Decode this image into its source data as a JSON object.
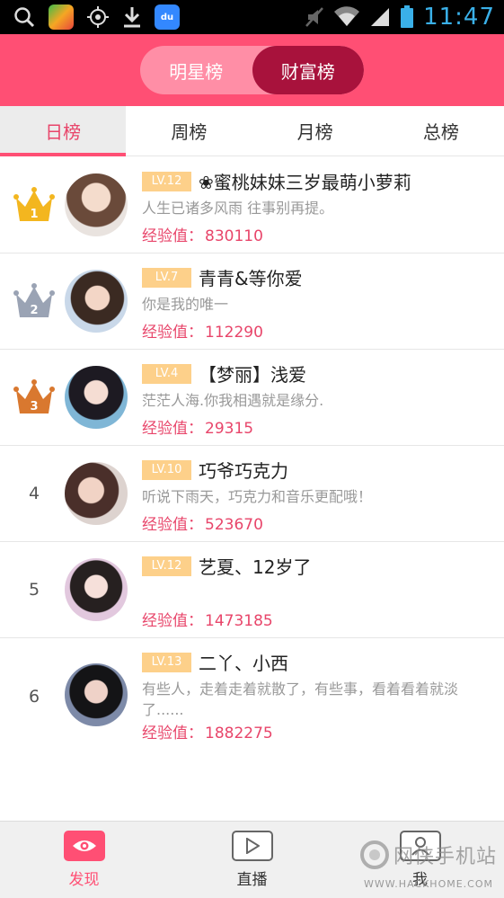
{
  "status_bar": {
    "time": "11:47",
    "icons": [
      "search-icon",
      "game-app-icon",
      "gps-icon",
      "download-icon",
      "baidu-app-icon",
      "mute-icon",
      "wifi-icon",
      "signal-icon",
      "battery-icon"
    ],
    "baidu_label": "du"
  },
  "header": {
    "segments": [
      {
        "label": "明星榜",
        "active": false
      },
      {
        "label": "财富榜",
        "active": true
      }
    ]
  },
  "tabs": [
    {
      "label": "日榜",
      "active": true
    },
    {
      "label": "周榜",
      "active": false
    },
    {
      "label": "月榜",
      "active": false
    },
    {
      "label": "总榜",
      "active": false
    }
  ],
  "list": [
    {
      "rank": "1",
      "crown": "gold",
      "level": "LV.12",
      "name": "❀蜜桃妹妹三岁最萌小萝莉",
      "signature": "人生已诸多风雨 往事别再提。",
      "exp_label": "经验值：",
      "exp_value": "830110"
    },
    {
      "rank": "2",
      "crown": "silver",
      "level": "LV.7",
      "name": "青青&等你爱",
      "signature": "你是我的唯一",
      "exp_label": "经验值：",
      "exp_value": "112290"
    },
    {
      "rank": "3",
      "crown": "bronze",
      "level": "LV.4",
      "name": "【梦丽】浅爱",
      "signature": "茫茫人海.你我相遇就是缘分.",
      "exp_label": "经验值：",
      "exp_value": "29315"
    },
    {
      "rank": "4",
      "crown": "",
      "level": "LV.10",
      "name": "巧爷巧克力",
      "signature": "听说下雨天，巧克力和音乐更配哦！",
      "exp_label": "经验值：",
      "exp_value": "523670"
    },
    {
      "rank": "5",
      "crown": "",
      "level": "LV.12",
      "name": "艺夏、12岁了",
      "signature": "",
      "exp_label": "经验值：",
      "exp_value": "1473185"
    },
    {
      "rank": "6",
      "crown": "",
      "level": "LV.13",
      "name": "二丫、小西",
      "signature": "有些人，走着走着就散了，有些事，看着看着就淡了......",
      "exp_label": "经验值：",
      "exp_value": "1882275"
    }
  ],
  "bottom_nav": [
    {
      "label": "发现",
      "icon": "eye-icon",
      "active": true
    },
    {
      "label": "直播",
      "icon": "play-icon",
      "active": false
    },
    {
      "label": "我",
      "icon": "person-icon",
      "active": false
    }
  ],
  "watermark": {
    "text": "网侠手机站",
    "url": "WWW.HACKHOME.COM"
  },
  "colors": {
    "brand": "#ff4f74",
    "segment_active": "#a8123c",
    "level_badge": "#fdd08a",
    "gold": "#f3b61f",
    "silver": "#9aa3b4",
    "bronze": "#d9782f"
  }
}
